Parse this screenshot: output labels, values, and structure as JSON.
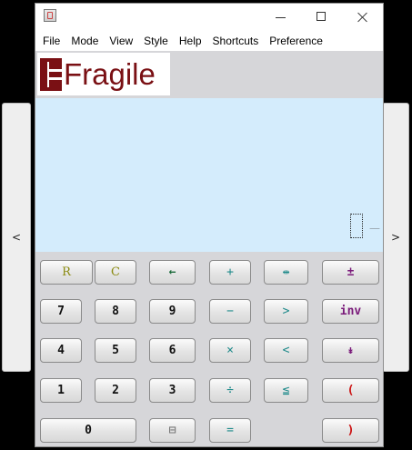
{
  "menu": [
    "File",
    "Mode",
    "View",
    "Style",
    "Help",
    "Shortcuts",
    "Preference"
  ],
  "logo": {
    "text": "Fragile"
  },
  "side_panels": {
    "left_arrow": "<",
    "right_arrow": ">"
  },
  "display": {
    "value": "",
    "dash": "—"
  },
  "keypad": {
    "rows": [
      [
        "R",
        "C",
        "←",
        "+",
        "⇹",
        "±"
      ],
      [
        "7",
        "8",
        "9",
        "−",
        ">",
        "inv"
      ],
      [
        "4",
        "5",
        "6",
        "×",
        "<",
        "↡"
      ],
      [
        "1",
        "2",
        "3",
        "÷",
        "≦",
        "("
      ],
      [
        "0",
        "⊟",
        "=",
        ")"
      ]
    ]
  },
  "colors": {
    "display_bg": "#d4ecfc",
    "brand": "#7a1014",
    "olive_key": "#8a8a10",
    "teal_key": "#1f8a8a",
    "purple_key": "#7a1a7a",
    "red_key": "#cc1111"
  }
}
